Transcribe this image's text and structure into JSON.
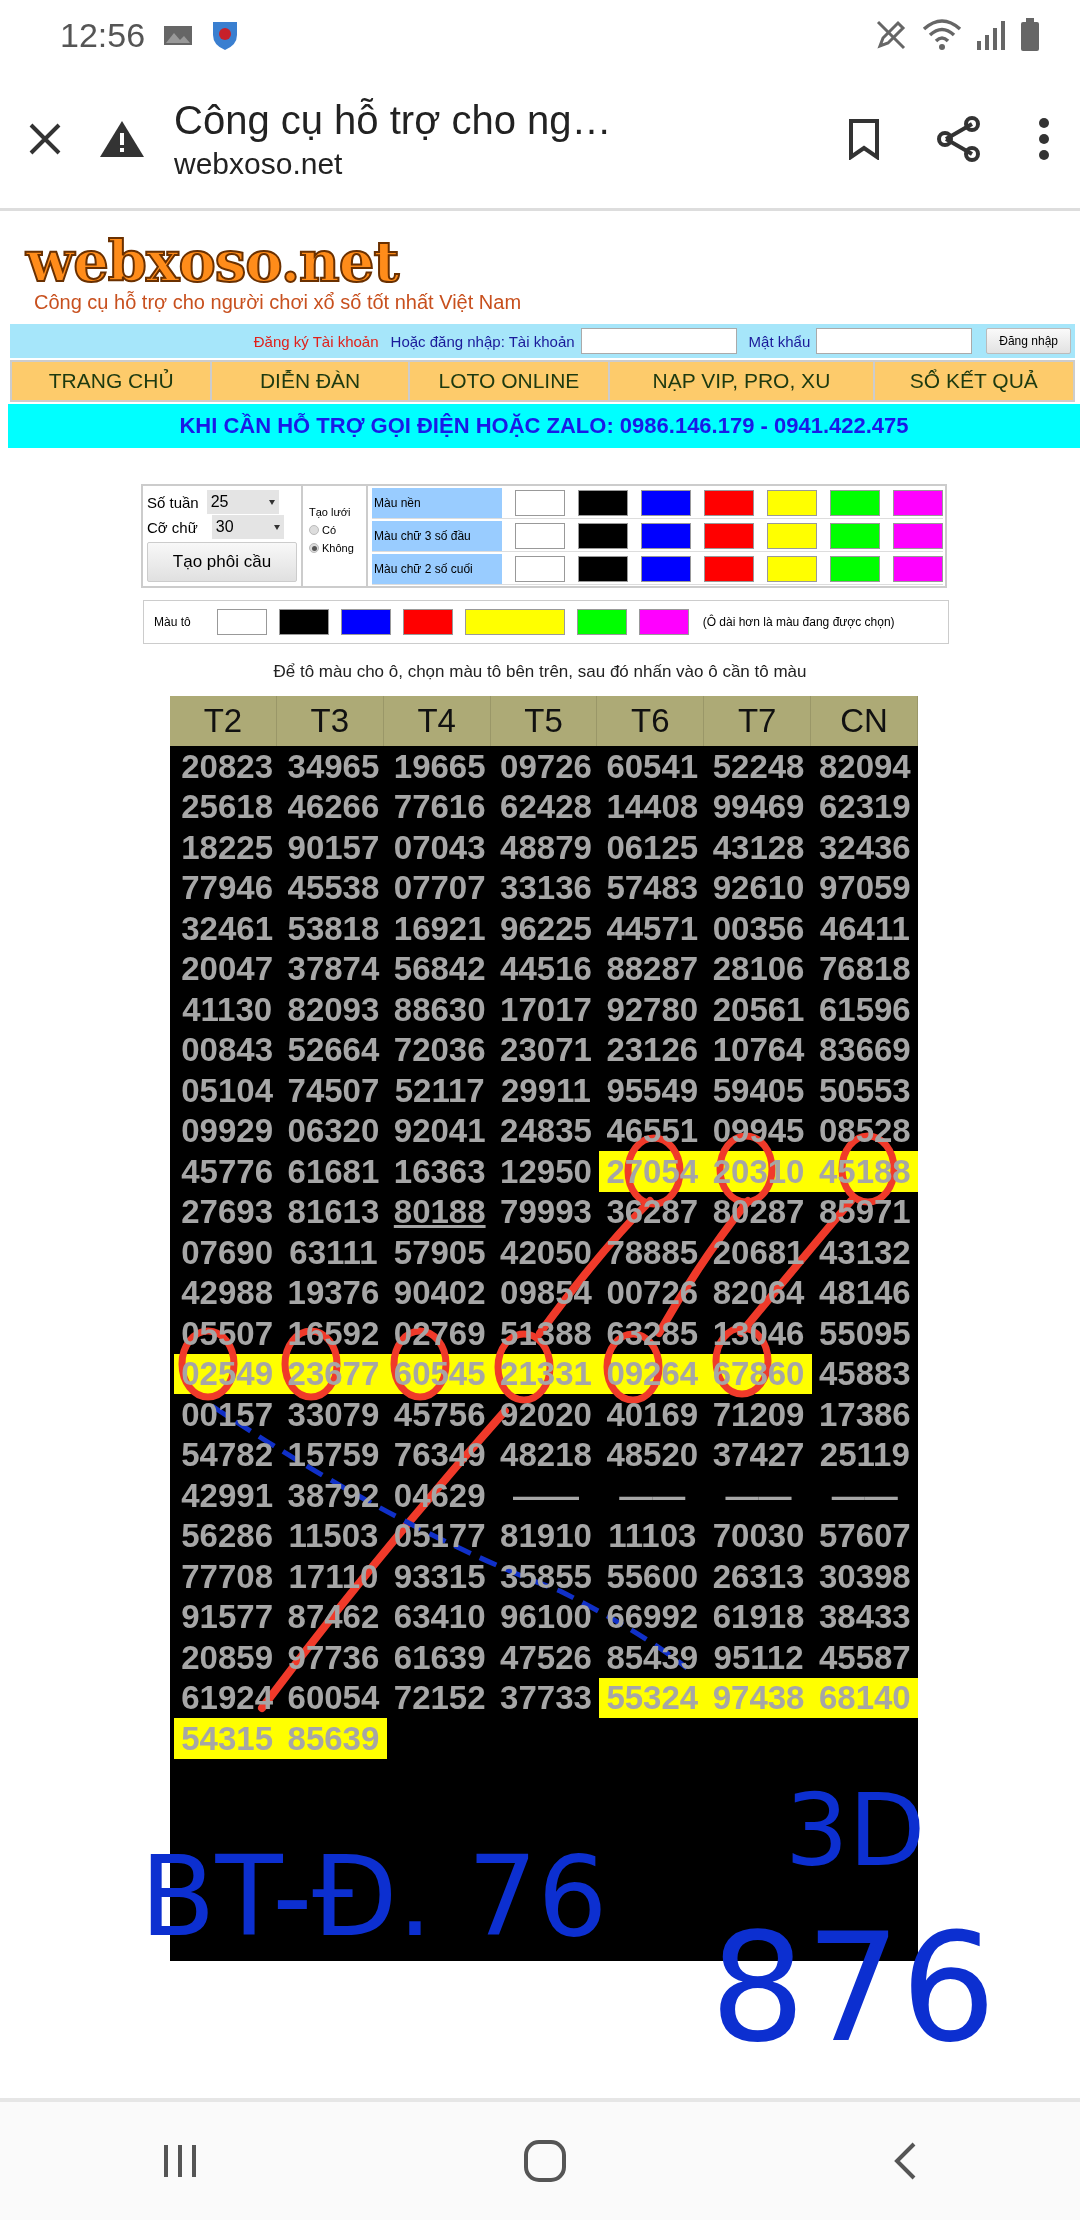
{
  "status_bar": {
    "time": "12:56"
  },
  "browser": {
    "title": "Công cụ hỗ trợ cho ng…",
    "url": "webxoso.net"
  },
  "site": {
    "logo": "webxoso.net",
    "tagline": "Công cụ hỗ trợ cho người chơi xổ số tốt nhất Việt Nam"
  },
  "login": {
    "register_link": "Đăng ký Tài khoản",
    "prompt": "Hoặc đăng nhập: Tài khoản",
    "password_label": "Mật khẩu",
    "button": "Đăng nhập"
  },
  "nav": [
    "TRANG CHỦ",
    "DIỄN ĐÀN",
    "LOTO ONLINE",
    "NẠP VIP, PRO, XU",
    "SỔ KẾT QUẢ"
  ],
  "banner": "KHI CẦN HỖ TRỢ GỌI ĐIỆN HOẶC ZALO: 0986.146.179 - 0941.422.475",
  "settings": {
    "weeks": {
      "label": "Số tuần",
      "value": "25"
    },
    "font_size": {
      "label": "Cỡ chữ",
      "value": "30"
    },
    "button": "Tạo phôi cầu",
    "grid": {
      "label": "Tạo lưới",
      "options": [
        {
          "label": "Có",
          "selected": false
        },
        {
          "label": "Không",
          "selected": true
        }
      ]
    },
    "color_rows": [
      {
        "label": "Màu nền",
        "swatches": [
          {
            "color": "#ffffff"
          },
          {
            "color": "#000000"
          },
          {
            "color": "#0000ff"
          },
          {
            "color": "#ff0000"
          },
          {
            "color": "#ffff00"
          },
          {
            "color": "#00ff00"
          },
          {
            "color": "#ff00ff"
          }
        ]
      },
      {
        "label": "Màu chữ 3 số đầu",
        "swatches": [
          {
            "color": "#ffffff"
          },
          {
            "color": "#000000"
          },
          {
            "color": "#0000ff"
          },
          {
            "color": "#ff0000"
          },
          {
            "color": "#ffff00"
          },
          {
            "color": "#00ff00"
          },
          {
            "color": "#ff00ff"
          }
        ]
      },
      {
        "label": "Màu chữ 2 số cuối",
        "swatches": [
          {
            "color": "#ffffff"
          },
          {
            "color": "#000000"
          },
          {
            "color": "#0000ff"
          },
          {
            "color": "#ff0000"
          },
          {
            "color": "#ffff00"
          },
          {
            "color": "#00ff00"
          },
          {
            "color": "#ff00ff"
          }
        ]
      }
    ]
  },
  "paint": {
    "label": "Màu tô",
    "swatches": [
      {
        "color": "#ffffff",
        "selected": false
      },
      {
        "color": "#000000",
        "selected": false
      },
      {
        "color": "#0000ff",
        "selected": false
      },
      {
        "color": "#ff0000",
        "selected": false
      },
      {
        "color": "#ffff00",
        "selected": true
      },
      {
        "color": "#00ff00",
        "selected": false
      },
      {
        "color": "#ff00ff",
        "selected": false
      }
    ],
    "note": "(Ô dài hơn là màu đang được chọn)"
  },
  "instruction": "Để tô màu cho ô, chọn màu tô bên trên, sau đó nhấn vào ô cần tô màu",
  "table": {
    "columns": [
      "T2",
      "T3",
      "T4",
      "T5",
      "T6",
      "T7",
      "CN"
    ],
    "rows": [
      [
        {
          "text": "20823",
          "highlighted": false,
          "underlined": false
        },
        {
          "text": "34965",
          "highlighted": false,
          "underlined": false
        },
        {
          "text": "19665",
          "highlighted": false,
          "underlined": false
        },
        {
          "text": "09726",
          "highlighted": false,
          "underlined": false
        },
        {
          "text": "60541",
          "highlighted": false,
          "underlined": false
        },
        {
          "text": "52248",
          "highlighted": false,
          "underlined": false
        },
        {
          "text": "82094",
          "highlighted": false,
          "underlined": false
        }
      ],
      [
        {
          "text": "25618",
          "highlighted": false,
          "underlined": false
        },
        {
          "text": "46266",
          "highlighted": false,
          "underlined": false
        },
        {
          "text": "77616",
          "highlighted": false,
          "underlined": false
        },
        {
          "text": "62428",
          "highlighted": false,
          "underlined": false
        },
        {
          "text": "14408",
          "highlighted": false,
          "underlined": false
        },
        {
          "text": "99469",
          "highlighted": false,
          "underlined": false
        },
        {
          "text": "62319",
          "highlighted": false,
          "underlined": false
        }
      ],
      [
        {
          "text": "18225",
          "highlighted": false,
          "underlined": false
        },
        {
          "text": "90157",
          "highlighted": false,
          "underlined": false
        },
        {
          "text": "07043",
          "highlighted": false,
          "underlined": false
        },
        {
          "text": "48879",
          "highlighted": false,
          "underlined": false
        },
        {
          "text": "06125",
          "highlighted": false,
          "underlined": false
        },
        {
          "text": "43128",
          "highlighted": false,
          "underlined": false
        },
        {
          "text": "32436",
          "highlighted": false,
          "underlined": false
        }
      ],
      [
        {
          "text": "77946",
          "highlighted": false,
          "underlined": false
        },
        {
          "text": "45538",
          "highlighted": false,
          "underlined": false
        },
        {
          "text": "07707",
          "highlighted": false,
          "underlined": false
        },
        {
          "text": "33136",
          "highlighted": false,
          "underlined": false
        },
        {
          "text": "57483",
          "highlighted": false,
          "underlined": false
        },
        {
          "text": "92610",
          "highlighted": false,
          "underlined": false
        },
        {
          "text": "97059",
          "highlighted": false,
          "underlined": false
        }
      ],
      [
        {
          "text": "32461",
          "highlighted": false,
          "underlined": false
        },
        {
          "text": "53818",
          "highlighted": false,
          "underlined": false
        },
        {
          "text": "16921",
          "highlighted": false,
          "underlined": false
        },
        {
          "text": "96225",
          "highlighted": false,
          "underlined": false
        },
        {
          "text": "44571",
          "highlighted": false,
          "underlined": false
        },
        {
          "text": "00356",
          "highlighted": false,
          "underlined": false
        },
        {
          "text": "46411",
          "highlighted": false,
          "underlined": false
        }
      ],
      [
        {
          "text": "20047",
          "highlighted": false,
          "underlined": false
        },
        {
          "text": "37874",
          "highlighted": false,
          "underlined": false
        },
        {
          "text": "56842",
          "highlighted": false,
          "underlined": false
        },
        {
          "text": "44516",
          "highlighted": false,
          "underlined": false
        },
        {
          "text": "88287",
          "highlighted": false,
          "underlined": false
        },
        {
          "text": "28106",
          "highlighted": false,
          "underlined": false
        },
        {
          "text": "76818",
          "highlighted": false,
          "underlined": false
        }
      ],
      [
        {
          "text": "41130",
          "highlighted": false,
          "underlined": false
        },
        {
          "text": "82093",
          "highlighted": false,
          "underlined": false
        },
        {
          "text": "88630",
          "highlighted": false,
          "underlined": false
        },
        {
          "text": "17017",
          "highlighted": false,
          "underlined": false
        },
        {
          "text": "92780",
          "highlighted": false,
          "underlined": false
        },
        {
          "text": "20561",
          "highlighted": false,
          "underlined": false
        },
        {
          "text": "61596",
          "highlighted": false,
          "underlined": false
        }
      ],
      [
        {
          "text": "00843",
          "highlighted": false,
          "underlined": false
        },
        {
          "text": "52664",
          "highlighted": false,
          "underlined": false
        },
        {
          "text": "72036",
          "highlighted": false,
          "underlined": false
        },
        {
          "text": "23071",
          "highlighted": false,
          "underlined": false
        },
        {
          "text": "23126",
          "highlighted": false,
          "underlined": false
        },
        {
          "text": "10764",
          "highlighted": false,
          "underlined": false
        },
        {
          "text": "83669",
          "highlighted": false,
          "underlined": false
        }
      ],
      [
        {
          "text": "05104",
          "highlighted": false,
          "underlined": false
        },
        {
          "text": "74507",
          "highlighted": false,
          "underlined": false
        },
        {
          "text": "52117",
          "highlighted": false,
          "underlined": false
        },
        {
          "text": "29911",
          "highlighted": false,
          "underlined": false
        },
        {
          "text": "95549",
          "highlighted": false,
          "underlined": false
        },
        {
          "text": "59405",
          "highlighted": false,
          "underlined": false
        },
        {
          "text": "50553",
          "highlighted": false,
          "underlined": false
        }
      ],
      [
        {
          "text": "09929",
          "highlighted": false,
          "underlined": false
        },
        {
          "text": "06320",
          "highlighted": false,
          "underlined": false
        },
        {
          "text": "92041",
          "highlighted": false,
          "underlined": false
        },
        {
          "text": "24835",
          "highlighted": false,
          "underlined": false
        },
        {
          "text": "46551",
          "highlighted": false,
          "underlined": false
        },
        {
          "text": "09945",
          "highlighted": false,
          "underlined": false
        },
        {
          "text": "08528",
          "highlighted": false,
          "underlined": false
        }
      ],
      [
        {
          "text": "45776",
          "highlighted": false,
          "underlined": false
        },
        {
          "text": "61681",
          "highlighted": false,
          "underlined": false
        },
        {
          "text": "16363",
          "highlighted": false,
          "underlined": false
        },
        {
          "text": "12950",
          "highlighted": false,
          "underlined": false
        },
        {
          "text": "27054",
          "highlighted": true,
          "underlined": false
        },
        {
          "text": "20310",
          "highlighted": true,
          "underlined": false
        },
        {
          "text": "45188",
          "highlighted": true,
          "underlined": false
        }
      ],
      [
        {
          "text": "27693",
          "highlighted": false,
          "underlined": false
        },
        {
          "text": "81613",
          "highlighted": false,
          "underlined": false
        },
        {
          "text": "80188",
          "highlighted": false,
          "underlined": true
        },
        {
          "text": "79993",
          "highlighted": false,
          "underlined": false
        },
        {
          "text": "36287",
          "highlighted": false,
          "underlined": false
        },
        {
          "text": "80287",
          "highlighted": false,
          "underlined": false
        },
        {
          "text": "85971",
          "highlighted": false,
          "underlined": false
        }
      ],
      [
        {
          "text": "07690",
          "highlighted": false,
          "underlined": false
        },
        {
          "text": "63111",
          "highlighted": false,
          "underlined": false
        },
        {
          "text": "57905",
          "highlighted": false,
          "underlined": false
        },
        {
          "text": "42050",
          "highlighted": false,
          "underlined": false
        },
        {
          "text": "78885",
          "highlighted": false,
          "underlined": false
        },
        {
          "text": "20681",
          "highlighted": false,
          "underlined": false
        },
        {
          "text": "43132",
          "highlighted": false,
          "underlined": false
        }
      ],
      [
        {
          "text": "42988",
          "highlighted": false,
          "underlined": false
        },
        {
          "text": "19376",
          "highlighted": false,
          "underlined": false
        },
        {
          "text": "90402",
          "highlighted": false,
          "underlined": false
        },
        {
          "text": "09854",
          "highlighted": false,
          "underlined": false
        },
        {
          "text": "00726",
          "highlighted": false,
          "underlined": false
        },
        {
          "text": "82064",
          "highlighted": false,
          "underlined": false
        },
        {
          "text": "48146",
          "highlighted": false,
          "underlined": false
        }
      ],
      [
        {
          "text": "05507",
          "highlighted": false,
          "underlined": false
        },
        {
          "text": "16592",
          "highlighted": false,
          "underlined": false
        },
        {
          "text": "02769",
          "highlighted": false,
          "underlined": false
        },
        {
          "text": "51388",
          "highlighted": false,
          "underlined": false
        },
        {
          "text": "63285",
          "highlighted": false,
          "underlined": false
        },
        {
          "text": "13046",
          "highlighted": false,
          "underlined": false
        },
        {
          "text": "55095",
          "highlighted": false,
          "underlined": false
        }
      ],
      [
        {
          "text": "02549",
          "highlighted": true,
          "underlined": false
        },
        {
          "text": "23677",
          "highlighted": true,
          "underlined": false
        },
        {
          "text": "60545",
          "highlighted": true,
          "underlined": false
        },
        {
          "text": "21331",
          "highlighted": true,
          "underlined": false
        },
        {
          "text": "09264",
          "highlighted": true,
          "underlined": false
        },
        {
          "text": "67860",
          "highlighted": true,
          "underlined": false
        },
        {
          "text": "45883",
          "highlighted": false,
          "underlined": false
        }
      ],
      [
        {
          "text": "00157",
          "highlighted": false,
          "underlined": false
        },
        {
          "text": "33079",
          "highlighted": false,
          "underlined": false
        },
        {
          "text": "45756",
          "highlighted": false,
          "underlined": false
        },
        {
          "text": "92020",
          "highlighted": false,
          "underlined": false
        },
        {
          "text": "40169",
          "highlighted": false,
          "underlined": false
        },
        {
          "text": "71209",
          "highlighted": false,
          "underlined": false
        },
        {
          "text": "17386",
          "highlighted": false,
          "underlined": false
        }
      ],
      [
        {
          "text": "54782",
          "highlighted": false,
          "underlined": false
        },
        {
          "text": "15759",
          "highlighted": false,
          "underlined": false
        },
        {
          "text": "76349",
          "highlighted": false,
          "underlined": false
        },
        {
          "text": "48218",
          "highlighted": false,
          "underlined": false
        },
        {
          "text": "48520",
          "highlighted": false,
          "underlined": false
        },
        {
          "text": "37427",
          "highlighted": false,
          "underlined": false
        },
        {
          "text": "25119",
          "highlighted": false,
          "underlined": false
        }
      ],
      [
        {
          "text": "42991",
          "highlighted": false,
          "underlined": false
        },
        {
          "text": "38792",
          "highlighted": false,
          "underlined": false
        },
        {
          "text": "04629",
          "highlighted": false,
          "underlined": false
        },
        {
          "text": "——",
          "highlighted": false,
          "underlined": false
        },
        {
          "text": "——",
          "highlighted": false,
          "underlined": false
        },
        {
          "text": "——",
          "highlighted": false,
          "underlined": false
        },
        {
          "text": "——",
          "highlighted": false,
          "underlined": false
        }
      ],
      [
        {
          "text": "56286",
          "highlighted": false,
          "underlined": false
        },
        {
          "text": "11503",
          "highlighted": false,
          "underlined": false
        },
        {
          "text": "05177",
          "highlighted": false,
          "underlined": false
        },
        {
          "text": "81910",
          "highlighted": false,
          "underlined": false
        },
        {
          "text": "11103",
          "highlighted": false,
          "underlined": false
        },
        {
          "text": "70030",
          "highlighted": false,
          "underlined": false
        },
        {
          "text": "57607",
          "highlighted": false,
          "underlined": false
        }
      ],
      [
        {
          "text": "77708",
          "highlighted": false,
          "underlined": false
        },
        {
          "text": "17110",
          "highlighted": false,
          "underlined": false
        },
        {
          "text": "93315",
          "highlighted": false,
          "underlined": false
        },
        {
          "text": "35855",
          "highlighted": false,
          "underlined": false
        },
        {
          "text": "55600",
          "highlighted": false,
          "underlined": false
        },
        {
          "text": "26313",
          "highlighted": false,
          "underlined": false
        },
        {
          "text": "30398",
          "highlighted": false,
          "underlined": false
        }
      ],
      [
        {
          "text": "91577",
          "highlighted": false,
          "underlined": false
        },
        {
          "text": "87462",
          "highlighted": false,
          "underlined": false
        },
        {
          "text": "63410",
          "highlighted": false,
          "underlined": false
        },
        {
          "text": "96100",
          "highlighted": false,
          "underlined": false
        },
        {
          "text": "66992",
          "highlighted": false,
          "underlined": false
        },
        {
          "text": "61918",
          "highlighted": false,
          "underlined": false
        },
        {
          "text": "38433",
          "highlighted": false,
          "underlined": false
        }
      ],
      [
        {
          "text": "20859",
          "highlighted": false,
          "underlined": false
        },
        {
          "text": "97736",
          "highlighted": false,
          "underlined": false
        },
        {
          "text": "61639",
          "highlighted": false,
          "underlined": false
        },
        {
          "text": "47526",
          "highlighted": false,
          "underlined": false
        },
        {
          "text": "85439",
          "highlighted": false,
          "underlined": false
        },
        {
          "text": "95112",
          "highlighted": false,
          "underlined": false
        },
        {
          "text": "45587",
          "highlighted": false,
          "underlined": false
        }
      ],
      [
        {
          "text": "61924",
          "highlighted": false,
          "underlined": false
        },
        {
          "text": "60054",
          "highlighted": false,
          "underlined": false
        },
        {
          "text": "72152",
          "highlighted": false,
          "underlined": false
        },
        {
          "text": "37733",
          "highlighted": false,
          "underlined": false
        },
        {
          "text": "55324",
          "highlighted": true,
          "underlined": false
        },
        {
          "text": "97438",
          "highlighted": true,
          "underlined": false
        },
        {
          "text": "68140",
          "highlighted": true,
          "underlined": false
        }
      ],
      [
        {
          "text": "54315",
          "highlighted": true,
          "underlined": false
        },
        {
          "text": "85639",
          "highlighted": true,
          "underlined": false
        }
      ]
    ]
  },
  "annotations": {
    "notes": [
      "BT-Đ. 76",
      "3D",
      "876"
    ]
  }
}
